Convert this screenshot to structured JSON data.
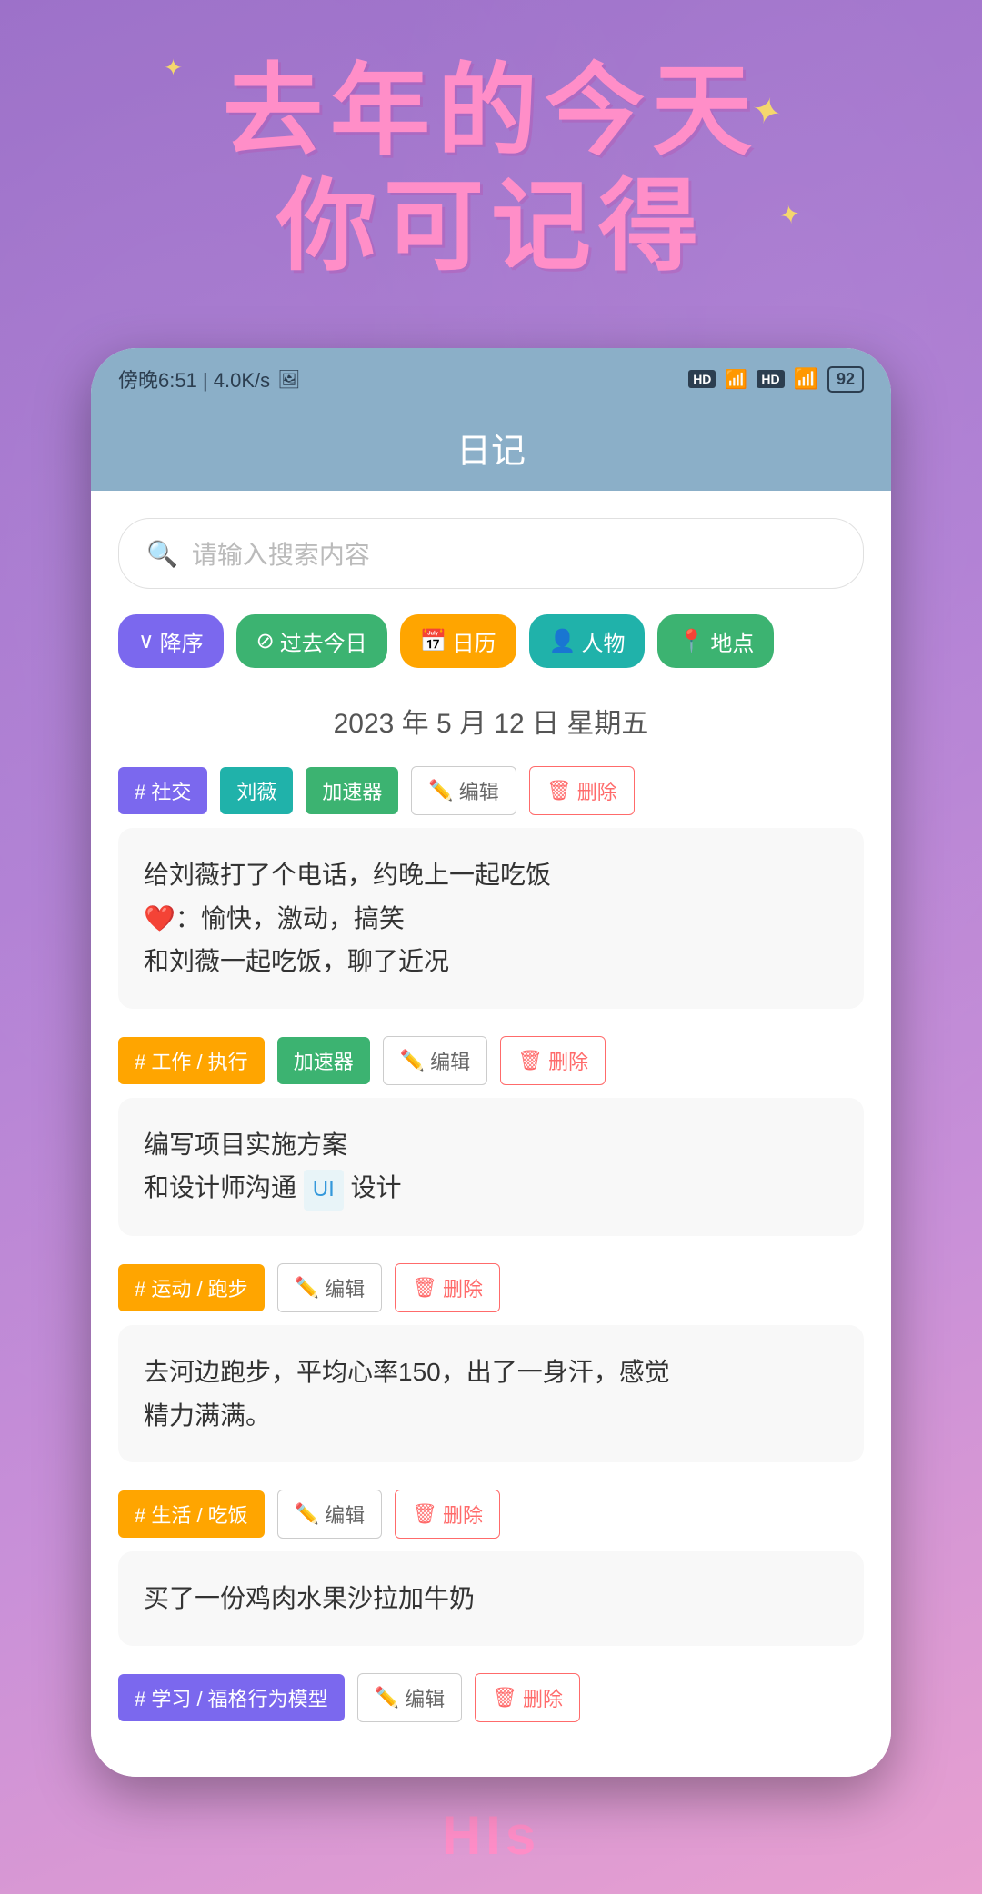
{
  "header": {
    "title_line1": "去年的今天",
    "title_line2": "你可记得"
  },
  "status_bar": {
    "time": "傍晚6:51",
    "network_speed": "4.0K/s",
    "hd_label1": "HD",
    "hd_label2": "HD",
    "battery": "92"
  },
  "app": {
    "title": "日记"
  },
  "search": {
    "placeholder": "请输入搜索内容"
  },
  "filters": [
    {
      "id": "sort",
      "label": "降序",
      "prefix": "∨",
      "style": "sort"
    },
    {
      "id": "past",
      "label": "过去今日",
      "style": "past"
    },
    {
      "id": "calendar",
      "label": "日历",
      "style": "calendar"
    },
    {
      "id": "person",
      "label": "人物",
      "style": "person"
    },
    {
      "id": "location",
      "label": "地点",
      "style": "location"
    }
  ],
  "date_header": "2023 年 5 月 12 日 星期五",
  "entries": [
    {
      "id": "entry1",
      "tags": [
        {
          "label": "# 社交",
          "style": "social"
        },
        {
          "label": "刘薇",
          "style": "person"
        },
        {
          "label": "加速器",
          "style": "booster"
        }
      ],
      "actions": [
        {
          "label": "编辑",
          "type": "edit"
        },
        {
          "label": "删除",
          "type": "delete"
        }
      ],
      "content_lines": [
        "给刘薇打了个电话，约晚上一起吃饭",
        "❤️：愉快，激动，搞笑",
        "和刘薇一起吃饭，聊了近况"
      ]
    },
    {
      "id": "entry2",
      "tags": [
        {
          "label": "# 工作 / 执行",
          "style": "work"
        },
        {
          "label": "加速器",
          "style": "booster"
        }
      ],
      "actions": [
        {
          "label": "编辑",
          "type": "edit"
        },
        {
          "label": "删除",
          "type": "delete"
        }
      ],
      "content_lines": [
        "编写项目实施方案",
        "和设计师沟通 UI 设计"
      ]
    },
    {
      "id": "entry3",
      "tags": [
        {
          "label": "# 运动 / 跑步",
          "style": "sport"
        }
      ],
      "actions": [
        {
          "label": "编辑",
          "type": "edit"
        },
        {
          "label": "删除",
          "type": "delete"
        }
      ],
      "content_lines": [
        "去河边跑步，平均心率150，出了一身汗，感觉",
        "精力满满。"
      ]
    },
    {
      "id": "entry4",
      "tags": [
        {
          "label": "# 生活 / 吃饭",
          "style": "life"
        }
      ],
      "actions": [
        {
          "label": "编辑",
          "type": "edit"
        },
        {
          "label": "删除",
          "type": "delete"
        }
      ],
      "content_lines": [
        "买了一份鸡肉水果沙拉加牛奶"
      ]
    },
    {
      "id": "entry5",
      "tags": [
        {
          "label": "# 学习 / 福格行为模型",
          "style": "study"
        }
      ],
      "actions": [
        {
          "label": "编辑",
          "type": "edit"
        },
        {
          "label": "删除",
          "type": "delete"
        }
      ],
      "content_lines": []
    }
  ],
  "bottom_label": "HIs"
}
